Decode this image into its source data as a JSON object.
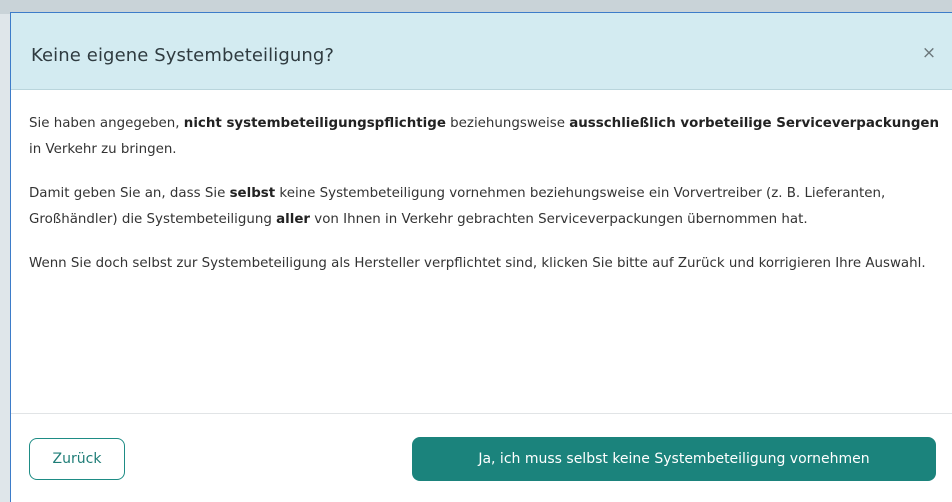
{
  "dialog": {
    "title": "Keine eigene Systembeteiligung?",
    "close_symbol": "×",
    "paragraphs": [
      {
        "t1": "Sie haben angegeben, ",
        "b1": "nicht systembeteiligungspflichtige",
        "t2": " beziehungsweise ",
        "b2": "ausschließlich vorbeteilige Serviceverpackungen",
        "t3": " in Verkehr zu bringen."
      },
      {
        "t1": "Damit geben Sie an, dass Sie ",
        "b1": "selbst",
        "t2": " keine Systembeteiligung vornehmen beziehungsweise ein Vorvertreiber (z. B. Lieferanten, Großhändler) die Systembeteiligung ",
        "b2": "aller",
        "t3": " von Ihnen in Verkehr gebrachten Serviceverpackungen übernommen hat."
      },
      {
        "t1": "Wenn Sie doch selbst zur Systembeteiligung als Hersteller verpflichtet sind, klicken Sie bitte auf Zurück und korrigieren Ihre Auswahl."
      }
    ],
    "back_label": "Zurück",
    "confirm_label": "Ja, ich muss selbst keine Systembeteiligung vornehmen"
  },
  "colors": {
    "header_bg": "#d3ebf1",
    "primary": "#1b837c",
    "border_accent": "#3d7cc9"
  },
  "icons": {
    "close": "close-icon"
  }
}
